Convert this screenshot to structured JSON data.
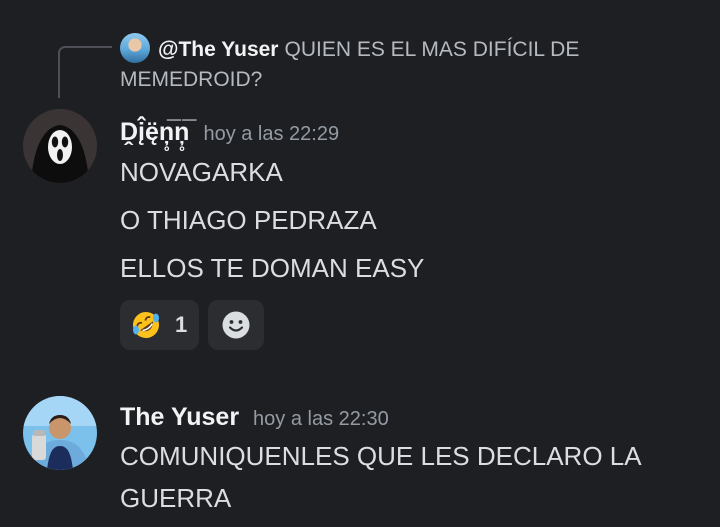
{
  "reply": {
    "author": "@The Yuser",
    "text": "QUIEN ES EL MAS DIFÍCIL DE MEMEDROID?",
    "avatar_icon": "city-player-avatar-icon"
  },
  "messages": [
    {
      "author": "Ḓį̂ę̈ņ̥̅ņ̥̅",
      "timestamp": "hoy a las 22:29",
      "avatar_icon": "ghostface-avatar-icon",
      "lines": [
        "NOVAGARKA",
        "O THIAGO PEDRAZA",
        "ELLOS TE DOMAN EASY"
      ],
      "reactions": [
        {
          "emoji": "rofl-emoji-icon",
          "count": "1"
        }
      ],
      "add_reaction_icon": "add-reaction-smile-icon"
    },
    {
      "author": "The Yuser",
      "timestamp": "hoy a las 22:30",
      "avatar_icon": "city-player-avatar-icon",
      "lines": [
        "COMUNIQUENLES QUE LES DECLARO LA GUERRA"
      ]
    }
  ],
  "colors": {
    "background": "#1e1f22",
    "reaction_bg": "#2b2d31",
    "author": "#f2f3f5",
    "text": "#dbdee1",
    "muted": "#949ba4"
  }
}
